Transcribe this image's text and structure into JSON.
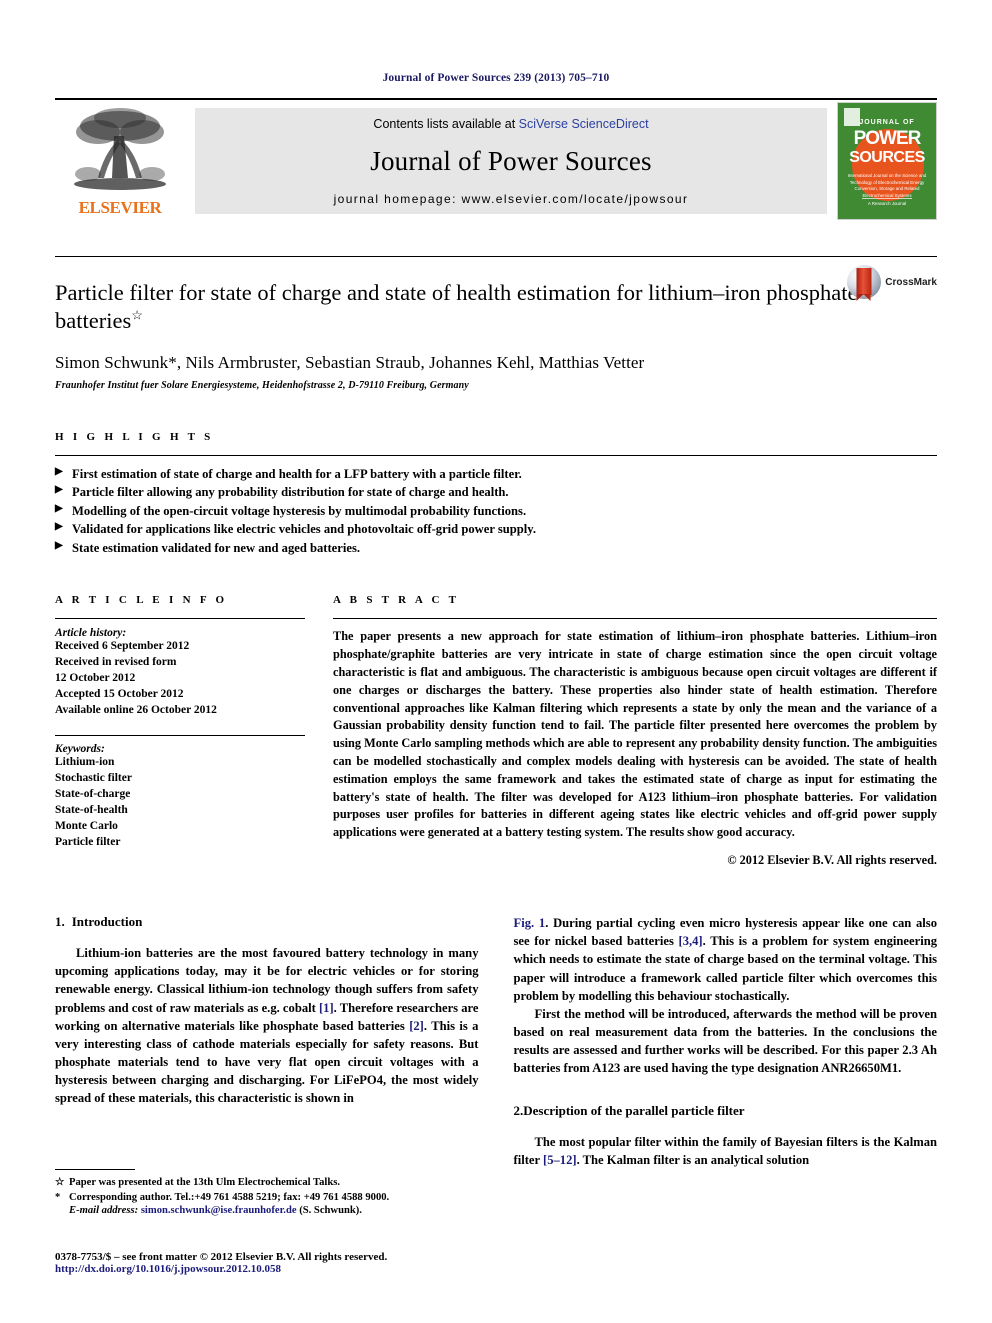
{
  "running_head": "Journal of Power Sources 239 (2013) 705–710",
  "masthead": {
    "publisher": "ELSEVIER",
    "contents_prefix": "Contents lists available at ",
    "contents_link": "SciVerse ScienceDirect",
    "journal_title": "Journal of Power Sources",
    "homepage": "journal homepage: www.elsevier.com/locate/jpowsour",
    "cover": {
      "kicker": "JOURNAL OF",
      "line1": "POWER",
      "line2": "SOURCES",
      "subtitle": "International Journal on the Science and Technology of Electrochemical Energy Conversion, Storage and Related Electrochemical Systems",
      "footer": "A Research Journal"
    }
  },
  "article": {
    "title": "Particle filter for state of charge and state of health estimation for lithium–iron phosphate batteries",
    "title_marker": "☆",
    "authors": "Simon Schwunk*, Nils Armbruster, Sebastian Straub, Johannes Kehl, Matthias Vetter",
    "affiliation": "Fraunhofer Institut fuer Solare Energiesysteme, Heidenhofstrasse 2, D-79110 Freiburg, Germany",
    "crossmark_label": "CrossMark"
  },
  "highlights": {
    "heading": "H I G H L I G H T S",
    "items": [
      "First estimation of state of charge and health for a LFP battery with a particle filter.",
      "Particle filter allowing any probability distribution for state of charge and health.",
      "Modelling of the open-circuit voltage hysteresis by multimodal probability functions.",
      "Validated for applications like electric vehicles and photovoltaic off-grid power supply.",
      "State estimation validated for new and aged batteries."
    ],
    "bullet_glyph": "▶"
  },
  "article_info": {
    "heading": "A R T I C L E  I N F O",
    "history_label": "Article history:",
    "history": [
      "Received 6 September 2012",
      "Received in revised form",
      "12 October 2012",
      "Accepted 15 October 2012",
      "Available online 26 October 2012"
    ],
    "keywords_label": "Keywords:",
    "keywords": [
      "Lithium-ion",
      "Stochastic filter",
      "State-of-charge",
      "State-of-health",
      "Monte Carlo",
      "Particle filter"
    ]
  },
  "abstract": {
    "heading": "A B S T R A C T",
    "text": "The paper presents a new approach for state estimation of lithium–iron phosphate batteries. Lithium–iron phosphate/graphite batteries are very intricate in state of charge estimation since the open circuit voltage characteristic is flat and ambiguous. The characteristic is ambiguous because open circuit voltages are different if one charges or discharges the battery. These properties also hinder state of health estimation. Therefore conventional approaches like Kalman filtering which represents a state by only the mean and the variance of a Gaussian probability density function tend to fail. The particle filter presented here overcomes the problem by using Monte Carlo sampling methods which are able to represent any probability density function. The ambiguities can be modelled stochastically and complex models dealing with hysteresis can be avoided. The state of health estimation employs the same framework and takes the estimated state of charge as input for estimating the battery's state of health. The filter was developed for A123 lithium–iron phosphate batteries. For validation purposes user profiles for batteries in different ageing states like electric vehicles and off-grid power supply applications were generated at a battery testing system. The results show good accuracy.",
    "copyright": "© 2012 Elsevier B.V. All rights reserved."
  },
  "sections": {
    "intro_number": "1.",
    "intro_title": "Introduction",
    "intro_p1_a": "Lithium-ion batteries are the most favoured battery technology in many upcoming applications today, may it be for electric vehicles or for storing renewable energy. Classical lithium-ion technology though suffers from safety problems and cost of raw materials as e.g. cobalt ",
    "intro_ref1": "[1]",
    "intro_p1_b": ". Therefore researchers are working on alternative materials like phosphate based batteries ",
    "intro_ref2": "[2]",
    "intro_p1_c": ". This is a very interesting class of cathode materials especially for safety reasons. But phosphate materials tend to have very flat open circuit voltages with a hysteresis between charging and discharging. For LiFePO4, the most widely spread of these materials, this characteristic is shown in ",
    "intro_figref": "Fig. 1",
    "intro_p1_d": ". During partial cycling even micro hysteresis appear like one can also see for nickel based batteries ",
    "intro_ref34": "[3,4]",
    "intro_p1_e": ". This is a problem for system engineering which needs to estimate the state of charge based on the terminal voltage. This paper will introduce a framework called particle filter which overcomes this problem by modelling this behaviour stochastically.",
    "intro_p2": "First the method will be introduced, afterwards the method will be proven based on real measurement data from the batteries. In the conclusions the results are assessed and further works will be described. For this paper 2.3 Ah batteries from A123 are used having the type designation ANR26650M1.",
    "sec2_number": "2.",
    "sec2_title": "Description of the parallel particle filter",
    "sec2_p1_a": "The most popular filter within the family of Bayesian filters is the Kalman filter ",
    "sec2_ref": "[5–12]",
    "sec2_p1_b": ". The Kalman filter is an analytical solution"
  },
  "footnotes": {
    "star_marker": "☆",
    "star_text": "Paper was presented at the 13th Ulm Electrochemical Talks.",
    "corr_marker": "*",
    "corr_text": "Corresponding author. Tel.:+49 761 4588 5219; fax: +49 761 4588 9000.",
    "email_label": "E-mail address:",
    "email": "simon.schwunk@ise.fraunhofer.de",
    "email_suffix": " (S. Schwunk)."
  },
  "colophon": {
    "issn_line": "0378-7753/$ – see front matter © 2012 Elsevier B.V. All rights reserved.",
    "doi_line": "http://dx.doi.org/10.1016/j.jpowsour.2012.10.058"
  },
  "colors": {
    "link": "#1b1b7a",
    "elsevier_orange": "#E9711C",
    "cover_green": "#3f8a33",
    "cover_sun": "#E8541E"
  }
}
